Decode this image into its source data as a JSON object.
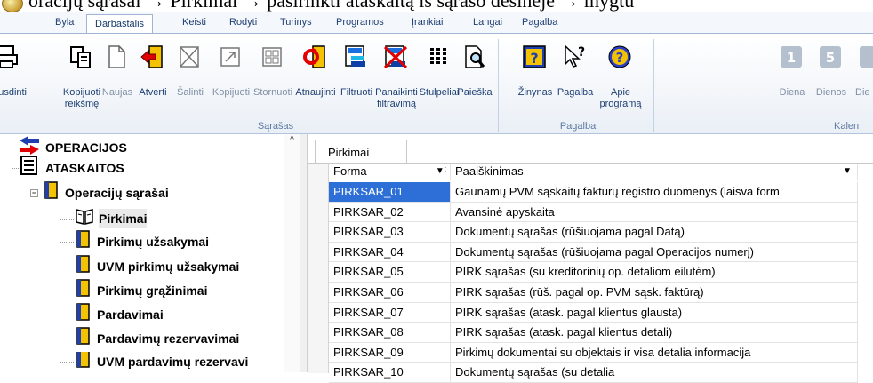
{
  "doc_text": "oracijų sąrašai → Pirkimai → pasirinkti ataskaitą iš sąrašo dešinėje → mygtu",
  "menu_tabs": [
    {
      "label": "Byla"
    },
    {
      "label": "Darbastalis"
    },
    {
      "label": "Keisti"
    },
    {
      "label": "Rodyti"
    },
    {
      "label": "Turinys"
    },
    {
      "label": "Programos"
    },
    {
      "label": "Įrankiai"
    },
    {
      "label": "Langai"
    },
    {
      "label": "Pagalba"
    }
  ],
  "ribbon": {
    "buttons": [
      {
        "label": "pausdinti",
        "icon": "printer-icon"
      },
      {
        "label": "Kopijuoti reikšmę",
        "icon": "copy-value-icon"
      },
      {
        "label": "Naujas",
        "icon": "new-document-icon"
      },
      {
        "label": "Atverti",
        "icon": "open-icon"
      },
      {
        "label": "Šalinti",
        "icon": "delete-icon"
      },
      {
        "label": "Kopijuoti",
        "icon": "copy-icon"
      },
      {
        "label": "Stornuoti",
        "icon": "storno-icon"
      },
      {
        "label": "Atnaujinti",
        "icon": "refresh-icon"
      },
      {
        "label": "Filtruoti",
        "icon": "filter-icon"
      },
      {
        "label": "Panaikinti filtravimą",
        "icon": "remove-filter-icon"
      },
      {
        "label": "Stulpeliai",
        "icon": "columns-icon"
      },
      {
        "label": "Paieška",
        "icon": "search-icon"
      },
      {
        "label": "Žinynas",
        "icon": "help-book-icon"
      },
      {
        "label": "Pagalba",
        "icon": "help-pointer-icon"
      },
      {
        "label": "Apie programą",
        "icon": "about-icon"
      },
      {
        "label": "Diena",
        "icon": "calendar-day-icon"
      },
      {
        "label": "Dienos",
        "icon": "calendar-days-icon"
      },
      {
        "label": "Die",
        "icon": "calendar-icon"
      }
    ],
    "groups": [
      {
        "label": "Sąrašas"
      },
      {
        "label": "Pagalba"
      },
      {
        "label": "Kalen"
      }
    ]
  },
  "tree": {
    "items": [
      {
        "label": "OPERACIJOS",
        "icon": "operations-icon"
      },
      {
        "label": "ATASKAITOS",
        "icon": "reports-icon"
      },
      {
        "label": "Operacijų sąrašai",
        "icon": "book-icon"
      },
      {
        "label": "Pirkimai",
        "icon": "open-book-icon"
      },
      {
        "label": "Pirkimų užsakymai",
        "icon": "book-icon"
      },
      {
        "label": "UVM pirkimų užsakymai",
        "icon": "book-icon"
      },
      {
        "label": "Pirkimų grąžinimai",
        "icon": "book-icon"
      },
      {
        "label": "Pardavimai",
        "icon": "book-icon"
      },
      {
        "label": "Pardavimų rezervavimai",
        "icon": "book-icon"
      },
      {
        "label": "UVM pardavimų rezervavi",
        "icon": "book-icon"
      }
    ]
  },
  "sheet": {
    "tab_label": "Pirkimai",
    "columns": [
      {
        "label": "Forma",
        "sort_marker": "▼ᵗ"
      },
      {
        "label": "Paaiškinimas",
        "sort_marker": "▼"
      }
    ],
    "rows": [
      {
        "forma": "PIRKSAR_01",
        "paaiskinimas": "Gaunamų PVM sąskaitų faktūrų registro duomenys (laisva form"
      },
      {
        "forma": "PIRKSAR_02",
        "paaiskinimas": "Avansinė apyskaita"
      },
      {
        "forma": "PIRKSAR_03",
        "paaiskinimas": "Dokumentų sąrašas (rūšiuojama pagal Datą)"
      },
      {
        "forma": "PIRKSAR_04",
        "paaiskinimas": "Dokumentų sąrašas (rūšiuojama pagal Operacijos numerį)"
      },
      {
        "forma": "PIRKSAR_05",
        "paaiskinimas": "PIRK sąrašas (su kreditorinių op. detaliom eilutėm)"
      },
      {
        "forma": "PIRKSAR_06",
        "paaiskinimas": "PIRK sąrašas (rūš. pagal op. PVM sąsk. faktūrą)"
      },
      {
        "forma": "PIRKSAR_07",
        "paaiskinimas": "PIRK sąrašas (atask. pagal klientus glausta)"
      },
      {
        "forma": "PIRKSAR_08",
        "paaiskinimas": "PIRK sąrašas (atask. pagal klientus detali)"
      },
      {
        "forma": "PIRKSAR_09",
        "paaiskinimas": "Pirkimų dokumentai su objektais ir visa detalia informacija"
      },
      {
        "forma": "PIRKSAR_10",
        "paaiskinimas": "Dokumentų sąrašas (su detalia"
      }
    ]
  },
  "colors": {
    "selection": "#2d6fd6",
    "ribbon_text": "#1e3f73",
    "tab_text": "#15386b"
  }
}
